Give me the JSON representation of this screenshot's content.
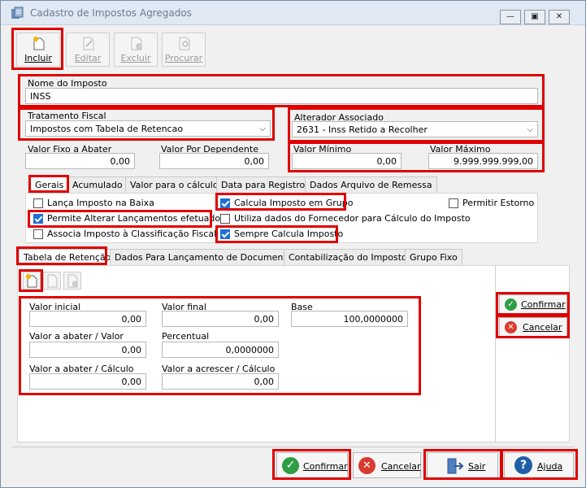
{
  "window": {
    "title": "Cadastro de Impostos Agregados",
    "controls": [
      "minimize-icon",
      "restore-icon",
      "close-icon"
    ]
  },
  "toolbar": {
    "incluir": "Incluir",
    "editar": "Editar",
    "excluir": "Excluir",
    "procurar": "Procurar"
  },
  "form": {
    "nome_label": "Nome do Imposto",
    "nome_value": "INSS",
    "tratamento_label": "Tratamento Fiscal",
    "tratamento_value": "Impostos com Tabela de Retencao",
    "alterador_label": "Alterador Associado",
    "alterador_value": "2631 - Inss Retido a Recolher",
    "valor_fixo_label": "Valor Fixo a Abater",
    "valor_fixo_value": "0,00",
    "valor_dep_label": "Valor Por Dependente",
    "valor_dep_value": "0,00",
    "valor_min_label": "Valor Mínimo",
    "valor_min_value": "0,00",
    "valor_max_label": "Valor Máximo",
    "valor_max_value": "9.999.999.999,00"
  },
  "top_tabs": [
    "Gerais",
    "Acumulado",
    "Valor para o cálculo",
    "Data para Registro",
    "Dados Arquivo de Remessa"
  ],
  "checkboxes": {
    "lanca_baixa": {
      "label": "Lança Imposto na Baixa",
      "checked": false
    },
    "permite_alterar": {
      "label": "Permite Alterar Lançamentos efetuados",
      "checked": true
    },
    "associa_classificacao": {
      "label": "Associa Imposto à Classificação Fiscal",
      "checked": false
    },
    "calcula_grupo": {
      "label": "Calcula Imposto em Grupo",
      "checked": true
    },
    "utiliza_fornecedor": {
      "label": "Utiliza dados do Fornecedor para Cálculo do Imposto",
      "checked": false
    },
    "sempre_calcula": {
      "label": "Sempre Calcula Imposto",
      "checked": true
    },
    "permitir_estorno": {
      "label": "Permitir Estorno",
      "checked": false
    }
  },
  "bottom_tabs": [
    "Tabela de Retenção",
    "Dados Para Lançamento de Documento",
    "Contabilização do Imposto",
    "Grupo Fixo"
  ],
  "retencao": {
    "valor_inicial_label": "Valor inicial",
    "valor_inicial_value": "0,00",
    "valor_final_label": "Valor final",
    "valor_final_value": "0,00",
    "base_label": "Base",
    "base_value": "100,0000000",
    "valor_abater_valor_label": "Valor a abater / Valor",
    "valor_abater_valor_value": "0,00",
    "percentual_label": "Percentual",
    "percentual_value": "0,0000000",
    "valor_abater_calc_label": "Valor a abater / Cálculo",
    "valor_abater_calc_value": "0,00",
    "valor_acrescer_label": "Valor a acrescer / Cálculo",
    "valor_acrescer_value": "0,00"
  },
  "side_buttons": {
    "confirmar": "Confirmar",
    "cancelar": "Cancelar"
  },
  "footer_buttons": {
    "confirmar": "Confirmar",
    "cancelar": "Cancelar",
    "sair": "Sair",
    "ajuda": "Ajuda"
  },
  "colors": {
    "highlight": "#e00000",
    "check": "#1e6fd6",
    "confirm_green": "#2e9e44",
    "cancel_red": "#d93a2f",
    "help_blue": "#1f5fa8"
  }
}
